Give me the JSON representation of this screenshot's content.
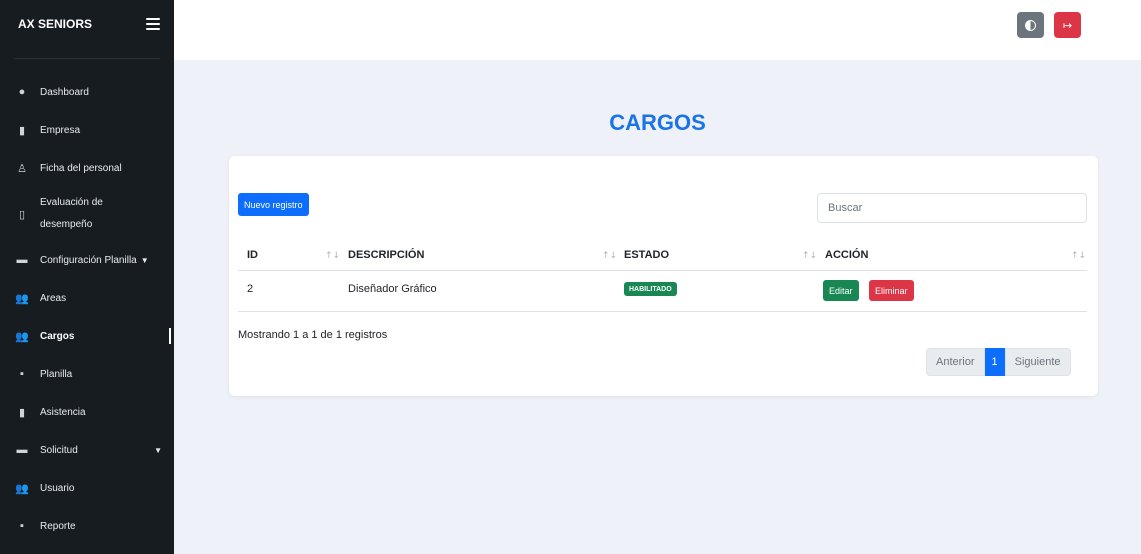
{
  "sidebar": {
    "brand": "AX SENIORS",
    "items": [
      {
        "label": "Dashboard",
        "icon": "●"
      },
      {
        "label": "Empresa",
        "icon": "▮"
      },
      {
        "label": "Ficha del personal",
        "icon": "♙"
      },
      {
        "label_line1": "Evaluación de",
        "label_line2": "desempeño",
        "icon": "▯"
      },
      {
        "label": "Configuración Planilla",
        "icon": "▬",
        "caret": "▼"
      },
      {
        "label": "Areas",
        "icon": "👥"
      },
      {
        "label": "Cargos",
        "icon": "👥"
      },
      {
        "label": "Planilla",
        "icon": "▪"
      },
      {
        "label": "Asistencia",
        "icon": "▮"
      },
      {
        "label": "Solicitud",
        "icon": "▬",
        "caret": "▼"
      },
      {
        "label": "Usuario",
        "icon": "👥"
      },
      {
        "label": "Reporte",
        "icon": "▪"
      }
    ]
  },
  "topbar": {
    "logout_glyph": "↦"
  },
  "main": {
    "title": "CARGOS",
    "new_button": "Nuevo registro",
    "search_placeholder": "Buscar",
    "table": {
      "columns": [
        "ID",
        "DESCRIPCIÓN",
        "ESTADO",
        "ACCIÓN"
      ],
      "sort_glyph": "↑↓",
      "rows": [
        {
          "id": "2",
          "descripcion": "Diseñador Gráfico",
          "estado": "HABILITADO",
          "edit": "Editar",
          "delete": "Eliminar"
        }
      ]
    },
    "info": "Mostrando 1 a 1 de 1 registros",
    "pagination": {
      "prev": "Anterior",
      "current": "1",
      "next": "Siguiente"
    }
  },
  "colors": {
    "sidebar_bg": "#171c21",
    "accent": "#1a73e8",
    "primary": "#0d6efd",
    "success": "#198754",
    "danger": "#dc3545"
  }
}
